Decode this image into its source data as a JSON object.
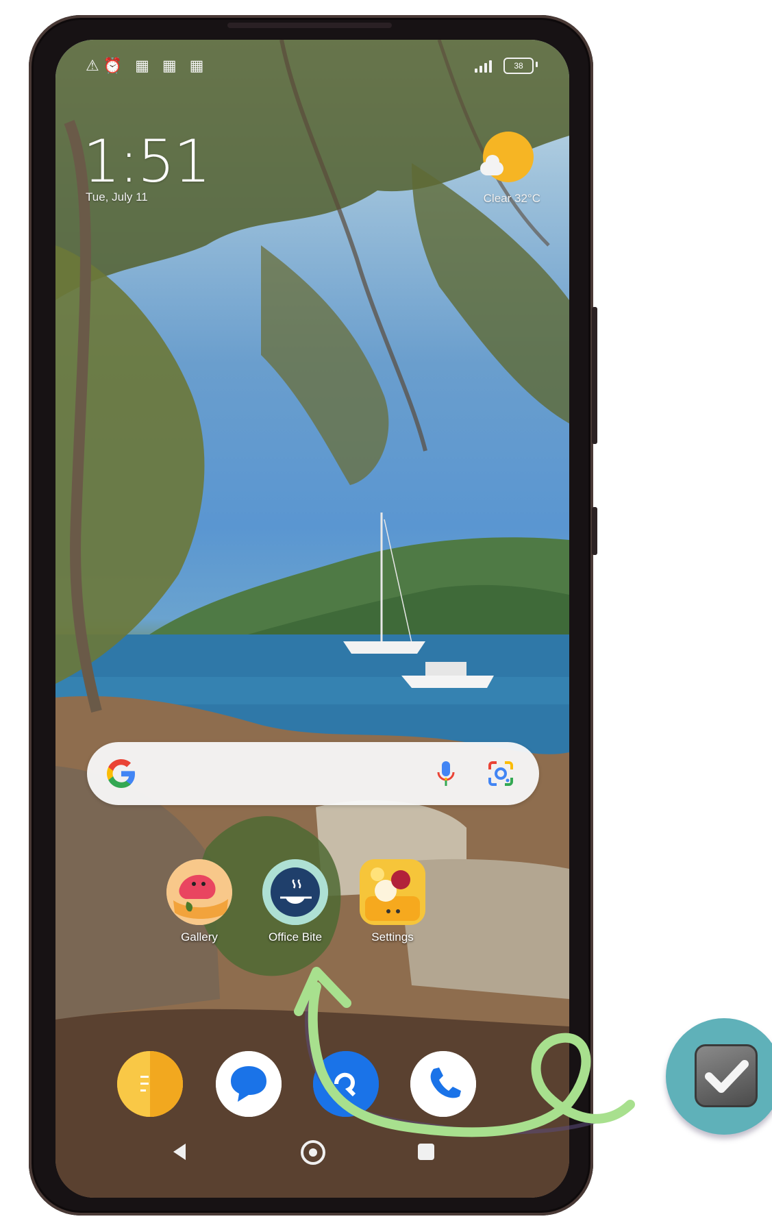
{
  "status_bar": {
    "left_icons": "⚠⏰ ▦ ▦ ▦",
    "battery": "38"
  },
  "clock": {
    "time": "1:51",
    "date": "Tue, July 11"
  },
  "weather": {
    "condition_temp": "Clear 32°C"
  },
  "search_bar": {
    "logo_letter": "G",
    "colors": {
      "blue": "#4285f4",
      "red": "#ea4335",
      "yellow": "#fbbc05",
      "green": "#34a853"
    }
  },
  "apps": [
    {
      "label": "Gallery",
      "icon": "gallery-icon"
    },
    {
      "label": "Office Bite",
      "icon": "office-bite-icon"
    },
    {
      "label": "Settings",
      "icon": "settings-icon"
    }
  ],
  "dock": [
    {
      "icon": "notes-icon",
      "color": "#f7b733"
    },
    {
      "icon": "messages-icon",
      "color": "#1a73e8"
    },
    {
      "icon": "maps-app-icon",
      "color": "#1a73e8"
    },
    {
      "icon": "phone-call-icon",
      "color": "#1a73e8"
    }
  ],
  "annotation": {
    "arrow_color": "#a8e08e",
    "badge_color": "#5fb1b9"
  }
}
